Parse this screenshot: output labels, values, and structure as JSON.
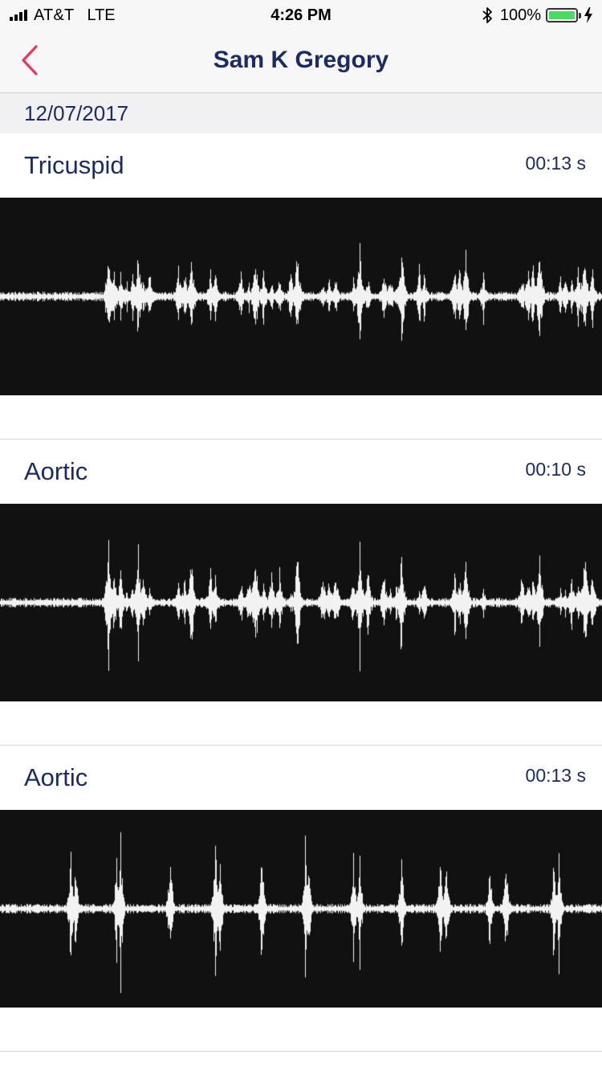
{
  "status_bar": {
    "carrier": "AT&T",
    "network": "LTE",
    "time": "4:26 PM",
    "battery_percent": "100%",
    "battery_level": 1.0,
    "battery_color": "#4cd964",
    "icons": [
      "signal-icon",
      "bluetooth-icon",
      "battery-icon",
      "charging-icon"
    ]
  },
  "nav": {
    "title": "Sam K Gregory",
    "back_icon": "chevron-left-icon",
    "accent_color": "#e8365d",
    "title_color": "#1c2b63"
  },
  "date_header": "12/07/2017",
  "recordings": [
    {
      "name": "Tricuspid",
      "duration": "00:13 s",
      "waveform_style": "dense"
    },
    {
      "name": "Aortic",
      "duration": "00:10 s",
      "waveform_style": "dense"
    },
    {
      "name": "Aortic",
      "duration": "00:13 s",
      "waveform_style": "beats"
    }
  ]
}
